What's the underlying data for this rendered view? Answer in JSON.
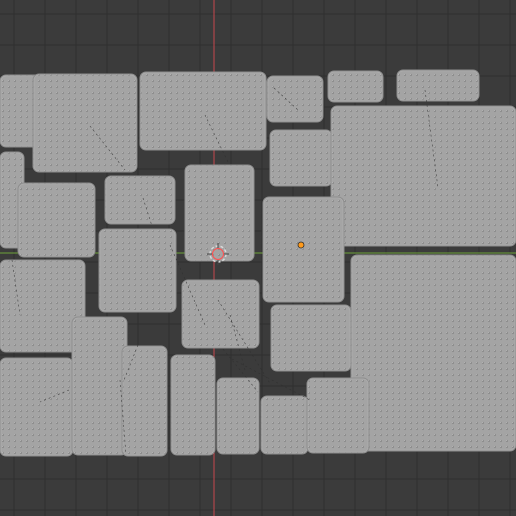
{
  "app": {
    "name": "",
    "viewport_title": ""
  },
  "scene": {
    "background": "#3b3b3b",
    "grid_line": "#2f2f2f",
    "grid_strong": "#272727",
    "axis_x": "#6ea33a",
    "axis_y": "#c7474d",
    "plate_fill": "#a3a3a3",
    "plate_edge": "#8e8e8e",
    "selected_dot": "#ff9a1a",
    "cursor_outer": "#d9d9d9",
    "cursor_inner": "#ff4f4f"
  },
  "icons": {
    "origin": "origin-icon",
    "cursor": "3d-cursor-icon"
  }
}
